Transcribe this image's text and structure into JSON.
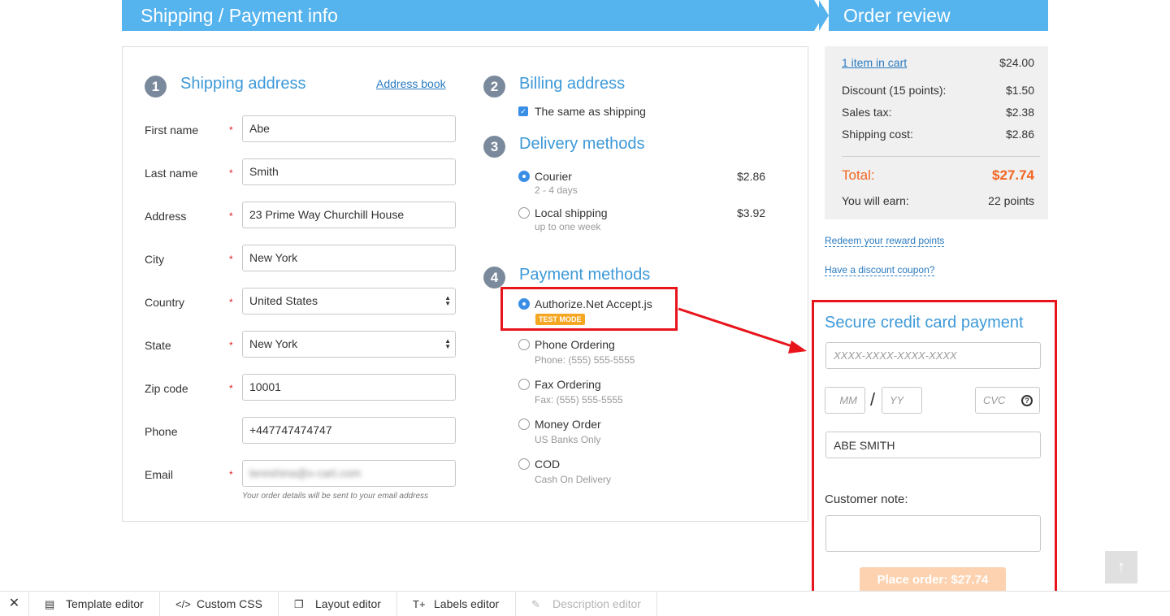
{
  "header": {
    "left_title": "Shipping / Payment info",
    "right_title": "Order review"
  },
  "shipping": {
    "step": "1",
    "title": "Shipping address",
    "address_book_link": "Address book",
    "fields": {
      "first_name": {
        "label": "First name",
        "value": "Abe",
        "required": "*"
      },
      "last_name": {
        "label": "Last name",
        "value": "Smith",
        "required": "*"
      },
      "address": {
        "label": "Address",
        "value": "23 Prime Way Churchill House",
        "required": "*"
      },
      "city": {
        "label": "City",
        "value": "New York",
        "required": "*"
      },
      "country": {
        "label": "Country",
        "value": "United States",
        "required": "*"
      },
      "state": {
        "label": "State",
        "value": "New York",
        "required": "*"
      },
      "zip": {
        "label": "Zip code",
        "value": "10001",
        "required": "*"
      },
      "phone": {
        "label": "Phone",
        "value": "+447747474747"
      },
      "email": {
        "label": "Email",
        "value": "tereshina@x-cart.com",
        "required": "*"
      }
    },
    "email_hint": "Your order details will be sent to your email address"
  },
  "billing": {
    "step": "2",
    "title": "Billing address",
    "same_as_shipping": "The same as shipping"
  },
  "delivery": {
    "step": "3",
    "title": "Delivery methods",
    "options": [
      {
        "name": "Courier",
        "desc": "2 - 4 days",
        "price": "$2.86"
      },
      {
        "name": "Local shipping",
        "desc": "up to one week",
        "price": "$3.92"
      }
    ]
  },
  "payment": {
    "step": "4",
    "title": "Payment methods",
    "options": [
      {
        "name": "Authorize.Net Accept.js",
        "badge": "TEST MODE"
      },
      {
        "name": "Phone Ordering",
        "desc": "Phone: (555) 555-5555"
      },
      {
        "name": "Fax Ordering",
        "desc": "Fax: (555) 555-5555"
      },
      {
        "name": "Money Order",
        "desc": "US Banks Only"
      },
      {
        "name": "COD",
        "desc": "Cash On Delivery"
      }
    ]
  },
  "summary": {
    "items_link": "1 item in cart",
    "items_value": "$24.00",
    "discount_label": "Discount (15 points):",
    "discount_value": "$1.50",
    "tax_label": "Sales tax:",
    "tax_value": "$2.38",
    "shipping_label": "Shipping cost:",
    "shipping_value": "$2.86",
    "total_label": "Total:",
    "total_value": "$27.74",
    "earn_label": "You will earn:",
    "earn_value": "22 points",
    "redeem_link": "Redeem your reward points",
    "coupon_link": "Have a discount coupon?"
  },
  "credit_card": {
    "title": "Secure credit card payment",
    "number_placeholder": "XXXX-XXXX-XXXX-XXXX",
    "mm_placeholder": "MM",
    "separator": "/",
    "yy_placeholder": "YY",
    "cvc_placeholder": "CVC",
    "help_glyph": "?",
    "name_value": "ABE SMITH",
    "note_label": "Customer note:",
    "place_order": "Place order: $27.74"
  },
  "scroll_top_glyph": "↑",
  "toolbar": {
    "close_glyph": "✕",
    "items": [
      {
        "label": "Template editor",
        "icon": "template-icon",
        "glyph": "▤"
      },
      {
        "label": "Custom CSS",
        "icon": "code-icon",
        "glyph": "</>"
      },
      {
        "label": "Layout editor",
        "icon": "layout-icon",
        "glyph": "❐"
      },
      {
        "label": "Labels editor",
        "icon": "text-icon",
        "glyph": "T+"
      },
      {
        "label": "Description editor",
        "icon": "edit-icon",
        "glyph": "✎"
      }
    ]
  },
  "colors": {
    "banner": "#55b3ee",
    "accent": "#3d99d8",
    "total": "#f26522",
    "highlight": "#e8141b"
  }
}
